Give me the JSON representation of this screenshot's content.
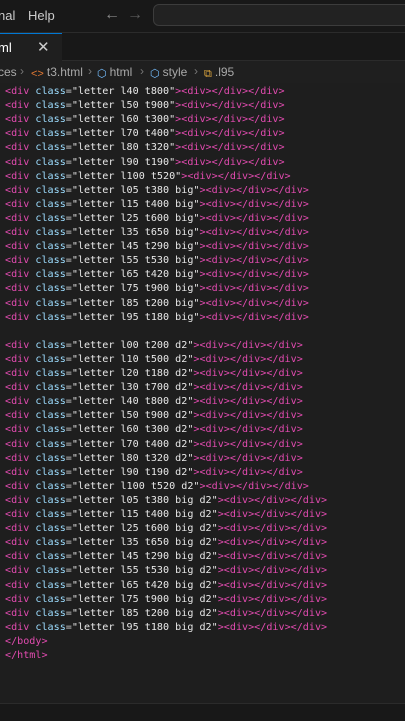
{
  "menu": {
    "items": [
      "nal",
      "Help"
    ]
  },
  "tab": {
    "label": "ml",
    "close": "✕"
  },
  "breadcrumb": {
    "items": [
      {
        "text": "ces",
        "icon": ""
      },
      {
        "text": "t3.html",
        "icon": "<>"
      },
      {
        "text": "html",
        "icon": "⬡"
      },
      {
        "text": "style",
        "icon": "⬡"
      },
      {
        "text": ".l95",
        "icon": "⧉"
      }
    ]
  },
  "editor": {
    "lines": [
      {
        "parts": [
          [
            "t",
            "<div"
          ],
          [
            "a",
            " class"
          ],
          [
            "pc",
            "="
          ],
          [
            "s",
            "\"letter l40 t800\""
          ],
          [
            "t",
            ">"
          ],
          [
            "t",
            "<div></div></div>"
          ]
        ]
      },
      {
        "parts": [
          [
            "t",
            "<div"
          ],
          [
            "a",
            " class"
          ],
          [
            "pc",
            "="
          ],
          [
            "s",
            "\"letter l50 t900\""
          ],
          [
            "t",
            ">"
          ],
          [
            "t",
            "<div></div></div>"
          ]
        ]
      },
      {
        "parts": [
          [
            "t",
            "<div"
          ],
          [
            "a",
            " class"
          ],
          [
            "pc",
            "="
          ],
          [
            "s",
            "\"letter l60 t300\""
          ],
          [
            "t",
            ">"
          ],
          [
            "t",
            "<div></div></div>"
          ]
        ]
      },
      {
        "parts": [
          [
            "t",
            "<div"
          ],
          [
            "a",
            " class"
          ],
          [
            "pc",
            "="
          ],
          [
            "s",
            "\"letter l70 t400\""
          ],
          [
            "t",
            ">"
          ],
          [
            "t",
            "<div></div></div>"
          ]
        ]
      },
      {
        "parts": [
          [
            "t",
            "<div"
          ],
          [
            "a",
            " class"
          ],
          [
            "pc",
            "="
          ],
          [
            "s",
            "\"letter l80 t320\""
          ],
          [
            "t",
            ">"
          ],
          [
            "t",
            "<div></div></div>"
          ]
        ]
      },
      {
        "parts": [
          [
            "t",
            "<div"
          ],
          [
            "a",
            " class"
          ],
          [
            "pc",
            "="
          ],
          [
            "s",
            "\"letter l90 t190\""
          ],
          [
            "t",
            ">"
          ],
          [
            "t",
            "<div></div></div>"
          ]
        ]
      },
      {
        "parts": [
          [
            "t",
            "<div"
          ],
          [
            "a",
            " class"
          ],
          [
            "pc",
            "="
          ],
          [
            "s",
            "\"letter l100 t520\""
          ],
          [
            "t",
            ">"
          ],
          [
            "t",
            "<div></div></div>"
          ]
        ]
      },
      {
        "parts": [
          [
            "t",
            "<div"
          ],
          [
            "a",
            " class"
          ],
          [
            "pc",
            "="
          ],
          [
            "s",
            "\"letter l05 t380 big\""
          ],
          [
            "t",
            ">"
          ],
          [
            "t",
            "<div></div></div>"
          ]
        ]
      },
      {
        "parts": [
          [
            "t",
            "<div"
          ],
          [
            "a",
            " class"
          ],
          [
            "pc",
            "="
          ],
          [
            "s",
            "\"letter l15 t400 big\""
          ],
          [
            "t",
            ">"
          ],
          [
            "t",
            "<div></div></div>"
          ]
        ]
      },
      {
        "parts": [
          [
            "t",
            "<div"
          ],
          [
            "a",
            " class"
          ],
          [
            "pc",
            "="
          ],
          [
            "s",
            "\"letter l25 t600 big\""
          ],
          [
            "t",
            ">"
          ],
          [
            "t",
            "<div></div></div>"
          ]
        ]
      },
      {
        "parts": [
          [
            "t",
            "<div"
          ],
          [
            "a",
            " class"
          ],
          [
            "pc",
            "="
          ],
          [
            "s",
            "\"letter l35 t650 big\""
          ],
          [
            "t",
            ">"
          ],
          [
            "t",
            "<div></div></div>"
          ]
        ]
      },
      {
        "parts": [
          [
            "t",
            "<div"
          ],
          [
            "a",
            " class"
          ],
          [
            "pc",
            "="
          ],
          [
            "s",
            "\"letter l45 t290 big\""
          ],
          [
            "t",
            ">"
          ],
          [
            "t",
            "<div></div></div>"
          ]
        ]
      },
      {
        "parts": [
          [
            "t",
            "<div"
          ],
          [
            "a",
            " class"
          ],
          [
            "pc",
            "="
          ],
          [
            "s",
            "\"letter l55 t530 big\""
          ],
          [
            "t",
            ">"
          ],
          [
            "t",
            "<div></div></div>"
          ]
        ]
      },
      {
        "parts": [
          [
            "t",
            "<div"
          ],
          [
            "a",
            " class"
          ],
          [
            "pc",
            "="
          ],
          [
            "s",
            "\"letter l65 t420 big\""
          ],
          [
            "t",
            ">"
          ],
          [
            "t",
            "<div></div></div>"
          ]
        ]
      },
      {
        "parts": [
          [
            "t",
            "<div"
          ],
          [
            "a",
            " class"
          ],
          [
            "pc",
            "="
          ],
          [
            "s",
            "\"letter l75 t900 big\""
          ],
          [
            "t",
            ">"
          ],
          [
            "t",
            "<div></div></div>"
          ]
        ]
      },
      {
        "parts": [
          [
            "t",
            "<div"
          ],
          [
            "a",
            " class"
          ],
          [
            "pc",
            "="
          ],
          [
            "s",
            "\"letter l85 t200 big\""
          ],
          [
            "t",
            ">"
          ],
          [
            "t",
            "<div></div></div>"
          ]
        ]
      },
      {
        "parts": [
          [
            "t",
            "<div"
          ],
          [
            "a",
            " class"
          ],
          [
            "pc",
            "="
          ],
          [
            "s",
            "\"letter l95 t180 big\""
          ],
          [
            "t",
            ">"
          ],
          [
            "t",
            "<div></div></div>"
          ]
        ]
      },
      {
        "parts": []
      },
      {
        "parts": [
          [
            "t",
            "<div"
          ],
          [
            "a",
            " class"
          ],
          [
            "pc",
            "="
          ],
          [
            "s",
            "\"letter l00 t200 d2\""
          ],
          [
            "t",
            ">"
          ],
          [
            "t",
            "<div></div></div>"
          ]
        ]
      },
      {
        "parts": [
          [
            "t",
            "<div"
          ],
          [
            "a",
            " class"
          ],
          [
            "pc",
            "="
          ],
          [
            "s",
            "\"letter l10 t500 d2\""
          ],
          [
            "t",
            ">"
          ],
          [
            "t",
            "<div></div></div>"
          ]
        ]
      },
      {
        "parts": [
          [
            "t",
            "<div"
          ],
          [
            "a",
            " class"
          ],
          [
            "pc",
            "="
          ],
          [
            "s",
            "\"letter l20 t180 d2\""
          ],
          [
            "t",
            ">"
          ],
          [
            "t",
            "<div></div></div>"
          ]
        ]
      },
      {
        "parts": [
          [
            "t",
            "<div"
          ],
          [
            "a",
            " class"
          ],
          [
            "pc",
            "="
          ],
          [
            "s",
            "\"letter l30 t700 d2\""
          ],
          [
            "t",
            ">"
          ],
          [
            "t",
            "<div></div></div>"
          ]
        ]
      },
      {
        "parts": [
          [
            "t",
            "<div"
          ],
          [
            "a",
            " class"
          ],
          [
            "pc",
            "="
          ],
          [
            "s",
            "\"letter l40 t800 d2\""
          ],
          [
            "t",
            ">"
          ],
          [
            "t",
            "<div></div></div>"
          ]
        ]
      },
      {
        "parts": [
          [
            "t",
            "<div"
          ],
          [
            "a",
            " class"
          ],
          [
            "pc",
            "="
          ],
          [
            "s",
            "\"letter l50 t900 d2\""
          ],
          [
            "t",
            ">"
          ],
          [
            "t",
            "<div></div></div>"
          ]
        ]
      },
      {
        "parts": [
          [
            "t",
            "<div"
          ],
          [
            "a",
            " class"
          ],
          [
            "pc",
            "="
          ],
          [
            "s",
            "\"letter l60 t300 d2\""
          ],
          [
            "t",
            ">"
          ],
          [
            "t",
            "<div></div></div>"
          ]
        ]
      },
      {
        "parts": [
          [
            "t",
            "<div"
          ],
          [
            "a",
            " class"
          ],
          [
            "pc",
            "="
          ],
          [
            "s",
            "\"letter l70 t400 d2\""
          ],
          [
            "t",
            ">"
          ],
          [
            "t",
            "<div></div></div>"
          ]
        ]
      },
      {
        "parts": [
          [
            "t",
            "<div"
          ],
          [
            "a",
            " class"
          ],
          [
            "pc",
            "="
          ],
          [
            "s",
            "\"letter l80 t320 d2\""
          ],
          [
            "t",
            ">"
          ],
          [
            "t",
            "<div></div></div>"
          ]
        ]
      },
      {
        "parts": [
          [
            "t",
            "<div"
          ],
          [
            "a",
            " class"
          ],
          [
            "pc",
            "="
          ],
          [
            "s",
            "\"letter l90 t190 d2\""
          ],
          [
            "t",
            ">"
          ],
          [
            "t",
            "<div></div></div>"
          ]
        ]
      },
      {
        "parts": [
          [
            "t",
            "<div"
          ],
          [
            "a",
            " class"
          ],
          [
            "pc",
            "="
          ],
          [
            "s",
            "\"letter l100 t520 d2\""
          ],
          [
            "t",
            ">"
          ],
          [
            "t",
            "<div></div></div>"
          ]
        ]
      },
      {
        "parts": [
          [
            "t",
            "<div"
          ],
          [
            "a",
            " class"
          ],
          [
            "pc",
            "="
          ],
          [
            "s",
            "\"letter l05 t380 big d2\""
          ],
          [
            "t",
            ">"
          ],
          [
            "t",
            "<div></div></div>"
          ]
        ]
      },
      {
        "parts": [
          [
            "t",
            "<div"
          ],
          [
            "a",
            " class"
          ],
          [
            "pc",
            "="
          ],
          [
            "s",
            "\"letter l15 t400 big d2\""
          ],
          [
            "t",
            ">"
          ],
          [
            "t",
            "<div></div></div>"
          ]
        ]
      },
      {
        "parts": [
          [
            "t",
            "<div"
          ],
          [
            "a",
            " class"
          ],
          [
            "pc",
            "="
          ],
          [
            "s",
            "\"letter l25 t600 big d2\""
          ],
          [
            "t",
            ">"
          ],
          [
            "t",
            "<div></div></div>"
          ]
        ]
      },
      {
        "parts": [
          [
            "t",
            "<div"
          ],
          [
            "a",
            " class"
          ],
          [
            "pc",
            "="
          ],
          [
            "s",
            "\"letter l35 t650 big d2\""
          ],
          [
            "t",
            ">"
          ],
          [
            "t",
            "<div></div></div>"
          ]
        ]
      },
      {
        "parts": [
          [
            "t",
            "<div"
          ],
          [
            "a",
            " class"
          ],
          [
            "pc",
            "="
          ],
          [
            "s",
            "\"letter l45 t290 big d2\""
          ],
          [
            "t",
            ">"
          ],
          [
            "t",
            "<div></div></div>"
          ]
        ]
      },
      {
        "parts": [
          [
            "t",
            "<div"
          ],
          [
            "a",
            " class"
          ],
          [
            "pc",
            "="
          ],
          [
            "s",
            "\"letter l55 t530 big d2\""
          ],
          [
            "t",
            ">"
          ],
          [
            "t",
            "<div></div></div>"
          ]
        ]
      },
      {
        "parts": [
          [
            "t",
            "<div"
          ],
          [
            "a",
            " class"
          ],
          [
            "pc",
            "="
          ],
          [
            "s",
            "\"letter l65 t420 big d2\""
          ],
          [
            "t",
            ">"
          ],
          [
            "t",
            "<div></div></div>"
          ]
        ]
      },
      {
        "parts": [
          [
            "t",
            "<div"
          ],
          [
            "a",
            " class"
          ],
          [
            "pc",
            "="
          ],
          [
            "s",
            "\"letter l75 t900 big d2\""
          ],
          [
            "t",
            ">"
          ],
          [
            "t",
            "<div></div></div>"
          ]
        ]
      },
      {
        "parts": [
          [
            "t",
            "<div"
          ],
          [
            "a",
            " class"
          ],
          [
            "pc",
            "="
          ],
          [
            "s",
            "\"letter l85 t200 big d2\""
          ],
          [
            "t",
            ">"
          ],
          [
            "t",
            "<div></div></div>"
          ]
        ]
      },
      {
        "parts": [
          [
            "t",
            "<div"
          ],
          [
            "a",
            " class"
          ],
          [
            "pc",
            "="
          ],
          [
            "s",
            "\"letter l95 t180 big d2\""
          ],
          [
            "t",
            ">"
          ],
          [
            "t",
            "<div></div></div>"
          ]
        ]
      },
      {
        "parts": [
          [
            "t",
            "</body>"
          ]
        ]
      },
      {
        "parts": [
          [
            "t",
            "</html>"
          ]
        ]
      }
    ]
  }
}
